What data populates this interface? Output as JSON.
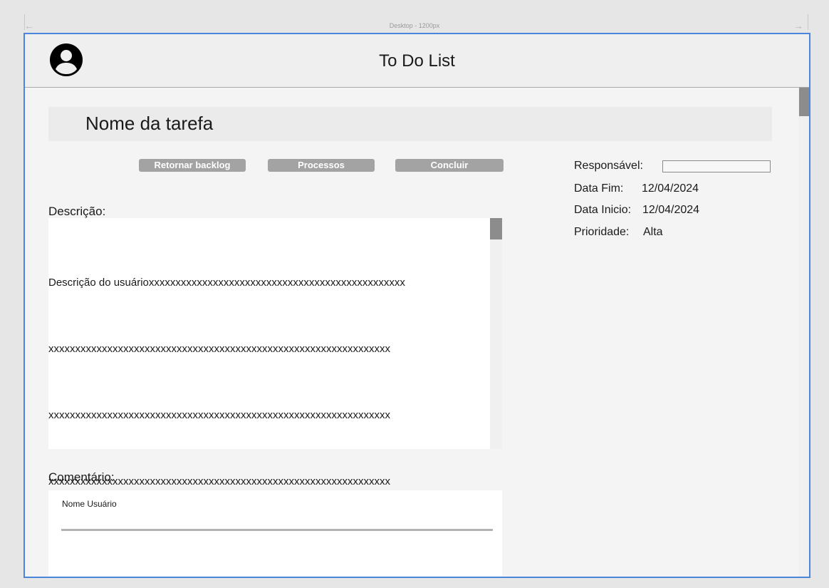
{
  "ruler": {
    "frame_label": "Desktop - 1200px"
  },
  "header": {
    "title": "To Do List",
    "avatar_icon": "user-circle-icon"
  },
  "task": {
    "name": "Nome da tarefa"
  },
  "actions": {
    "backlog_label": "Retornar backlog",
    "processos_label": "Processos",
    "concluir_label": "Concluir"
  },
  "description": {
    "label": "Descrição:",
    "lines": [
      "Descrição do usuárioxxxxxxxxxxxxxxxxxxxxxxxxxxxxxxxxxxxxxxxxxxxxxxxx",
      "xxxxxxxxxxxxxxxxxxxxxxxxxxxxxxxxxxxxxxxxxxxxxxxxxxxxxxxxxxxxxxxx",
      "xxxxxxxxxxxxxxxxxxxxxxxxxxxxxxxxxxxxxxxxxxxxxxxxxxxxxxxxxxxxxxxx",
      "xxxxxxxxxxxxxxxxxxxxxxxxxxxxxxxxxxxxxxxxxxxxxxxxxxxxxxxxxxxxxxxx"
    ]
  },
  "comment": {
    "label": "Comentário:",
    "user_name": "Nome Usuário"
  },
  "details": {
    "responsavel_label": "Responsável:",
    "responsavel_value": "",
    "data_fim_label": "Data Fim:",
    "data_fim_value": "12/04/2024",
    "data_inicio_label": "Data Inicio:",
    "data_inicio_value": "12/04/2024",
    "prioridade_label": "Prioridade:",
    "prioridade_value": "Alta"
  },
  "colors": {
    "frame_border": "#4a87dc",
    "button_bg": "#a3a3a3",
    "scroll_thumb": "#8c8c8c"
  }
}
